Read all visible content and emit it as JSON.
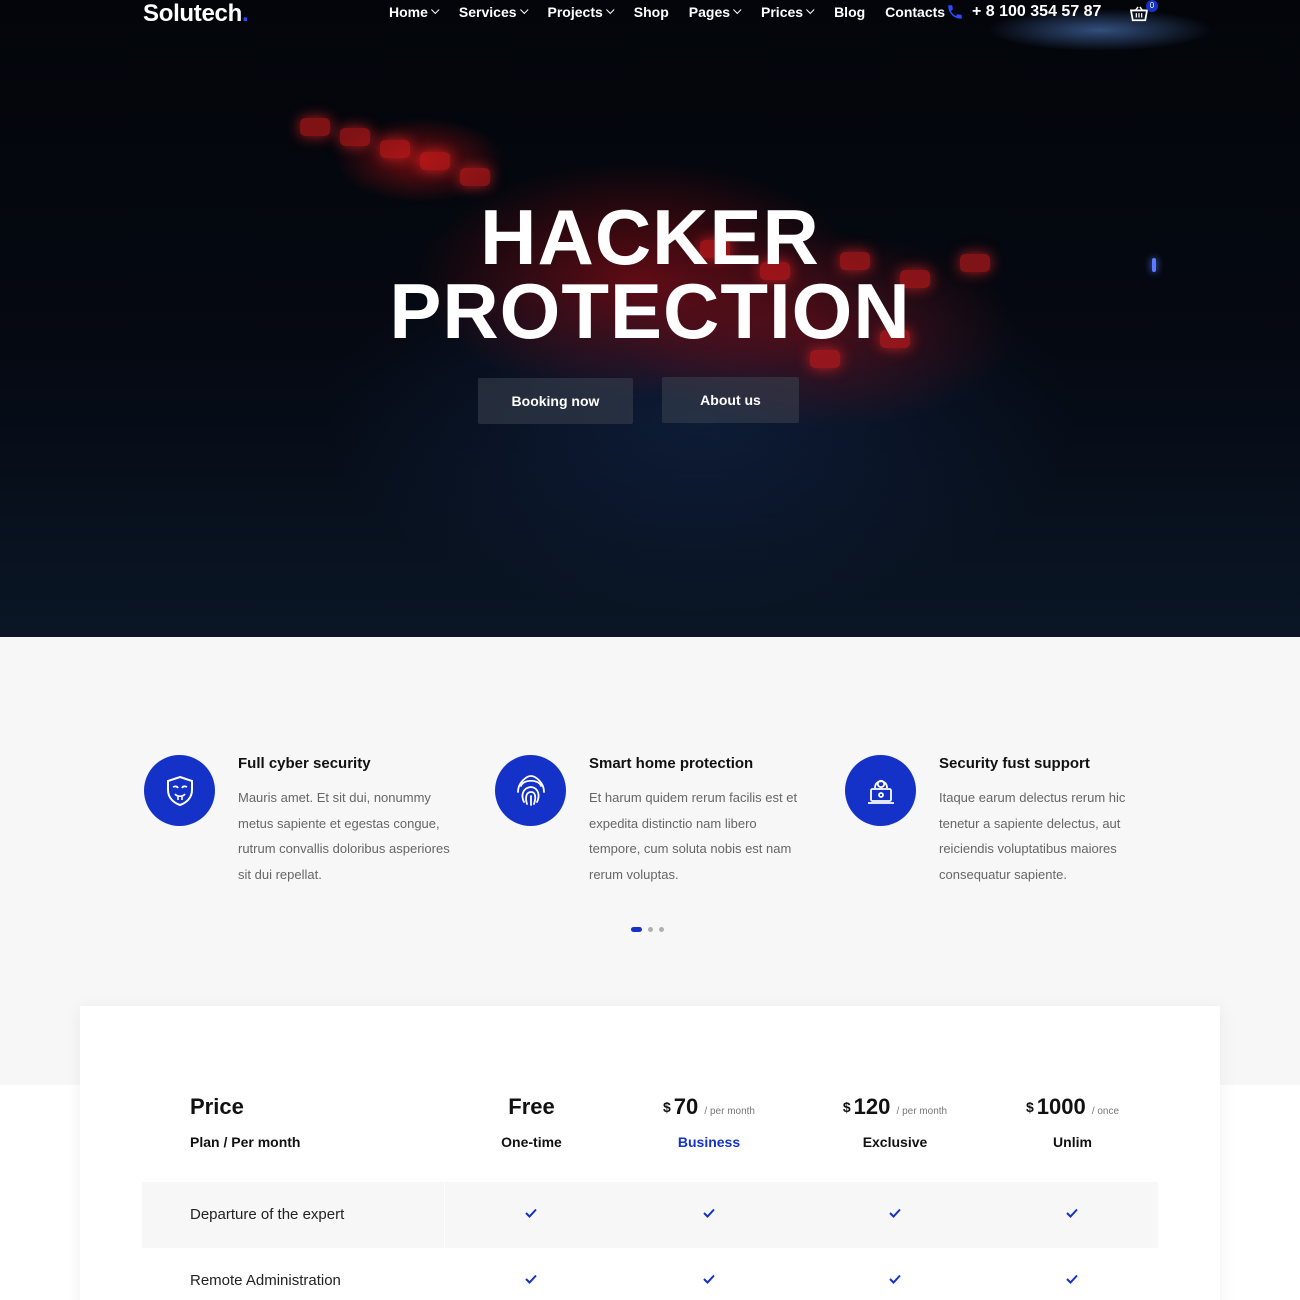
{
  "brand": {
    "name": "Solutech",
    "accent": "#1432c8"
  },
  "nav": {
    "items": [
      {
        "label": "Home",
        "dropdown": true
      },
      {
        "label": "Services",
        "dropdown": true
      },
      {
        "label": "Projects",
        "dropdown": true
      },
      {
        "label": "Shop",
        "dropdown": false
      },
      {
        "label": "Pages",
        "dropdown": true
      },
      {
        "label": "Prices",
        "dropdown": true
      },
      {
        "label": "Blog",
        "dropdown": false
      },
      {
        "label": "Contacts",
        "dropdown": false
      }
    ],
    "phone": "+ 8 100 354 57 87",
    "cart_count": "0"
  },
  "hero": {
    "title_line1": "HACKER",
    "title_line2": "PROTECTION",
    "booking_label": "Booking now",
    "about_label": "About us"
  },
  "features": [
    {
      "title": "Full cyber security",
      "text": "Mauris amet. Et sit dui, nonummy metus sapiente et egestas congue, rutrum convallis doloribus asperiores sit dui repellat.",
      "icon": "mask-shield-icon"
    },
    {
      "title": "Smart home protection",
      "text": "Et harum quidem rerum facilis est et expedita distinctio nam libero tempore, cum soluta nobis est nam rerum voluptas.",
      "icon": "fingerprint-icon"
    },
    {
      "title": "Security fust support",
      "text": "Itaque earum delectus rerum hic tenetur a sapiente delectus, aut reiciendis voluptatibus maiores consequatur sapiente.",
      "icon": "hacker-laptop-icon"
    }
  ],
  "carousel": {
    "active_index": 0,
    "count": 3
  },
  "pricing": {
    "label_head": "Price",
    "label_sub": "Plan / Per month",
    "plans": [
      {
        "currency": "",
        "amount": "Free",
        "period": "",
        "name": "One-time",
        "highlight": false
      },
      {
        "currency": "$",
        "amount": "70",
        "period": "/ per month",
        "name": "Business",
        "highlight": true
      },
      {
        "currency": "$",
        "amount": "120",
        "period": "/ per month",
        "name": "Exclusive",
        "highlight": false
      },
      {
        "currency": "$",
        "amount": "1000",
        "period": "/ once",
        "name": "Unlim",
        "highlight": false
      }
    ],
    "rows": [
      {
        "label": "Departure of the expert",
        "checks": [
          true,
          true,
          true,
          true
        ]
      },
      {
        "label": "Remote Administration",
        "checks": [
          true,
          true,
          true,
          true
        ]
      }
    ]
  }
}
